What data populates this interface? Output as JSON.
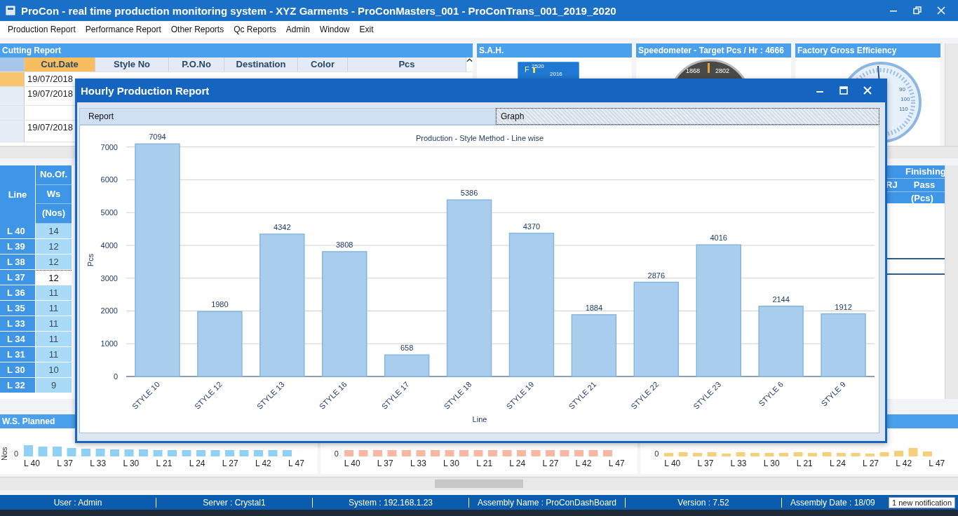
{
  "window": {
    "title": "ProCon - real time production monitoring system - XYZ Garments - ProConMasters_001 - ProConTrans_001_2019_2020"
  },
  "menu": [
    "Production Report",
    "Performance Report",
    "Other Reports",
    "Qc Reports",
    "Admin",
    "Window",
    "Exit"
  ],
  "cutting_report": {
    "title": "Cutting Report",
    "columns": [
      {
        "label": "Cut.Date",
        "selected": true
      },
      {
        "label": "Style No",
        "selected": false
      },
      {
        "label": "P.O.No",
        "selected": false
      },
      {
        "label": "Destination",
        "selected": false
      },
      {
        "label": "Color",
        "selected": false
      },
      {
        "label": "Pcs",
        "selected": false
      }
    ],
    "rows": [
      {
        "cut_date": "19/07/2018",
        "selected": true
      },
      {
        "cut_date": "19/07/2018",
        "selected": false
      },
      {
        "selected": false
      },
      {
        "cut_date": "19/07/2018",
        "selected": false
      }
    ]
  },
  "sah_panel": {
    "title": "S.A.H.",
    "gauge_labels": [
      "F",
      "2520",
      "2016"
    ]
  },
  "speedometer_panel": {
    "title": "Speedometer - Target Pcs / Hr : 4666",
    "gauge_labels": [
      "1868",
      "2802"
    ]
  },
  "efficiency_panel": {
    "title": "Factory Gross Efficiency",
    "gauge_labels": [
      "90",
      "100",
      "110"
    ]
  },
  "line_table": {
    "header": {
      "line": "Line",
      "ws_top": "No.Of.",
      "ws": "Ws",
      "ws_unit": "(Nos)"
    },
    "rows": [
      {
        "line": "L 40",
        "ws": "14",
        "selected": false
      },
      {
        "line": "L 39",
        "ws": "12",
        "selected": false
      },
      {
        "line": "L 38",
        "ws": "12",
        "selected": false
      },
      {
        "line": "L 37",
        "ws": "12",
        "selected": true
      },
      {
        "line": "L 36",
        "ws": "11",
        "selected": false
      },
      {
        "line": "L 35",
        "ws": "11",
        "selected": false
      },
      {
        "line": "L 33",
        "ws": "11",
        "selected": false
      },
      {
        "line": "L 34",
        "ws": "11",
        "selected": false
      },
      {
        "line": "L 31",
        "ws": "11",
        "selected": false
      },
      {
        "line": "L 30",
        "ws": "10",
        "selected": false
      },
      {
        "line": "L 32",
        "ws": "9",
        "selected": false
      }
    ]
  },
  "finishing_table": {
    "partial_column": "RJ",
    "group": "Finishing",
    "pass": "Pass",
    "unit": "(Pcs)"
  },
  "bottom_charts": {
    "title": "W.S. Planned",
    "panels": [
      {
        "ylabel": "Nos",
        "zero": "0",
        "color": "#8fd0f5",
        "x_labels": [
          "L 40",
          "L 37",
          "L 33",
          "L 30",
          "L 21",
          "L 24",
          "L 27",
          "L 42",
          "L 47"
        ]
      },
      {
        "zero": "0",
        "color": "#f7b7a3",
        "x_labels": [
          "L 40",
          "L 37",
          "L 33",
          "L 30",
          "L 21",
          "L 24",
          "L 27",
          "L 42",
          "L 47"
        ]
      },
      {
        "zero": "0",
        "color": "#f5cf7a",
        "x_labels": [
          "L 40",
          "L 37",
          "L 33",
          "L 30",
          "L 21",
          "L 24",
          "L 27",
          "L 42",
          "L 47"
        ]
      }
    ]
  },
  "modal": {
    "title": "Hourly Production Report",
    "tabs": [
      {
        "label": "Report",
        "selected": false
      },
      {
        "label": "Graph",
        "selected": true
      }
    ],
    "chart_data": {
      "type": "bar",
      "title": "Production - Style Method - Line wise",
      "xlabel": "Line",
      "ylabel": "Pcs",
      "categories": [
        "STYLE 10",
        "STYLE 12",
        "STYLE 13",
        "STYLE 16",
        "STYLE 17",
        "STYLE 18",
        "STYLE 19",
        "STYLE 21",
        "STYLE 22",
        "STYLE 23",
        "STYLE 6",
        "STYLE 9"
      ],
      "series": [
        {
          "color": "#a9cdec",
          "values": [
            7094,
            1980,
            4342,
            3808,
            658,
            5386,
            4370,
            1884,
            2876,
            4016,
            2144,
            1912
          ]
        }
      ],
      "ylim": [
        0,
        7100
      ],
      "yticks": [
        0,
        1000,
        2000,
        3000,
        4000,
        5000,
        6000,
        7000
      ],
      "grid": true,
      "data_labels": true
    }
  },
  "status_bar": [
    "User : Admin",
    "Server : Crystal1",
    "System : 192.168.1.23",
    "Assembly Name : ProConDashBoard",
    "Version : 7.52",
    "Assembly Date : 18/09"
  ],
  "notification": "1 new notification"
}
